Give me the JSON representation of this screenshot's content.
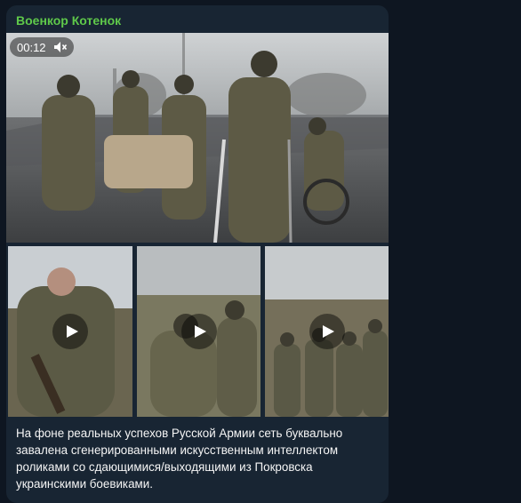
{
  "post": {
    "channel_name": "Военкор Котенок",
    "video_duration": "00:12",
    "caption": "На фоне реальных успехов Русской Армии сеть буквально завалена сгенерированными искусственным интеллектом роликами со сдающимися/выходящими из Покровска украинскими боевиками."
  },
  "icons": {
    "mute": "speaker-muted-icon",
    "play": "play-icon"
  },
  "colors": {
    "background": "#0e1621",
    "bubble": "#182533",
    "channel_name": "#5fc94a",
    "text": "#f5f5f5"
  }
}
